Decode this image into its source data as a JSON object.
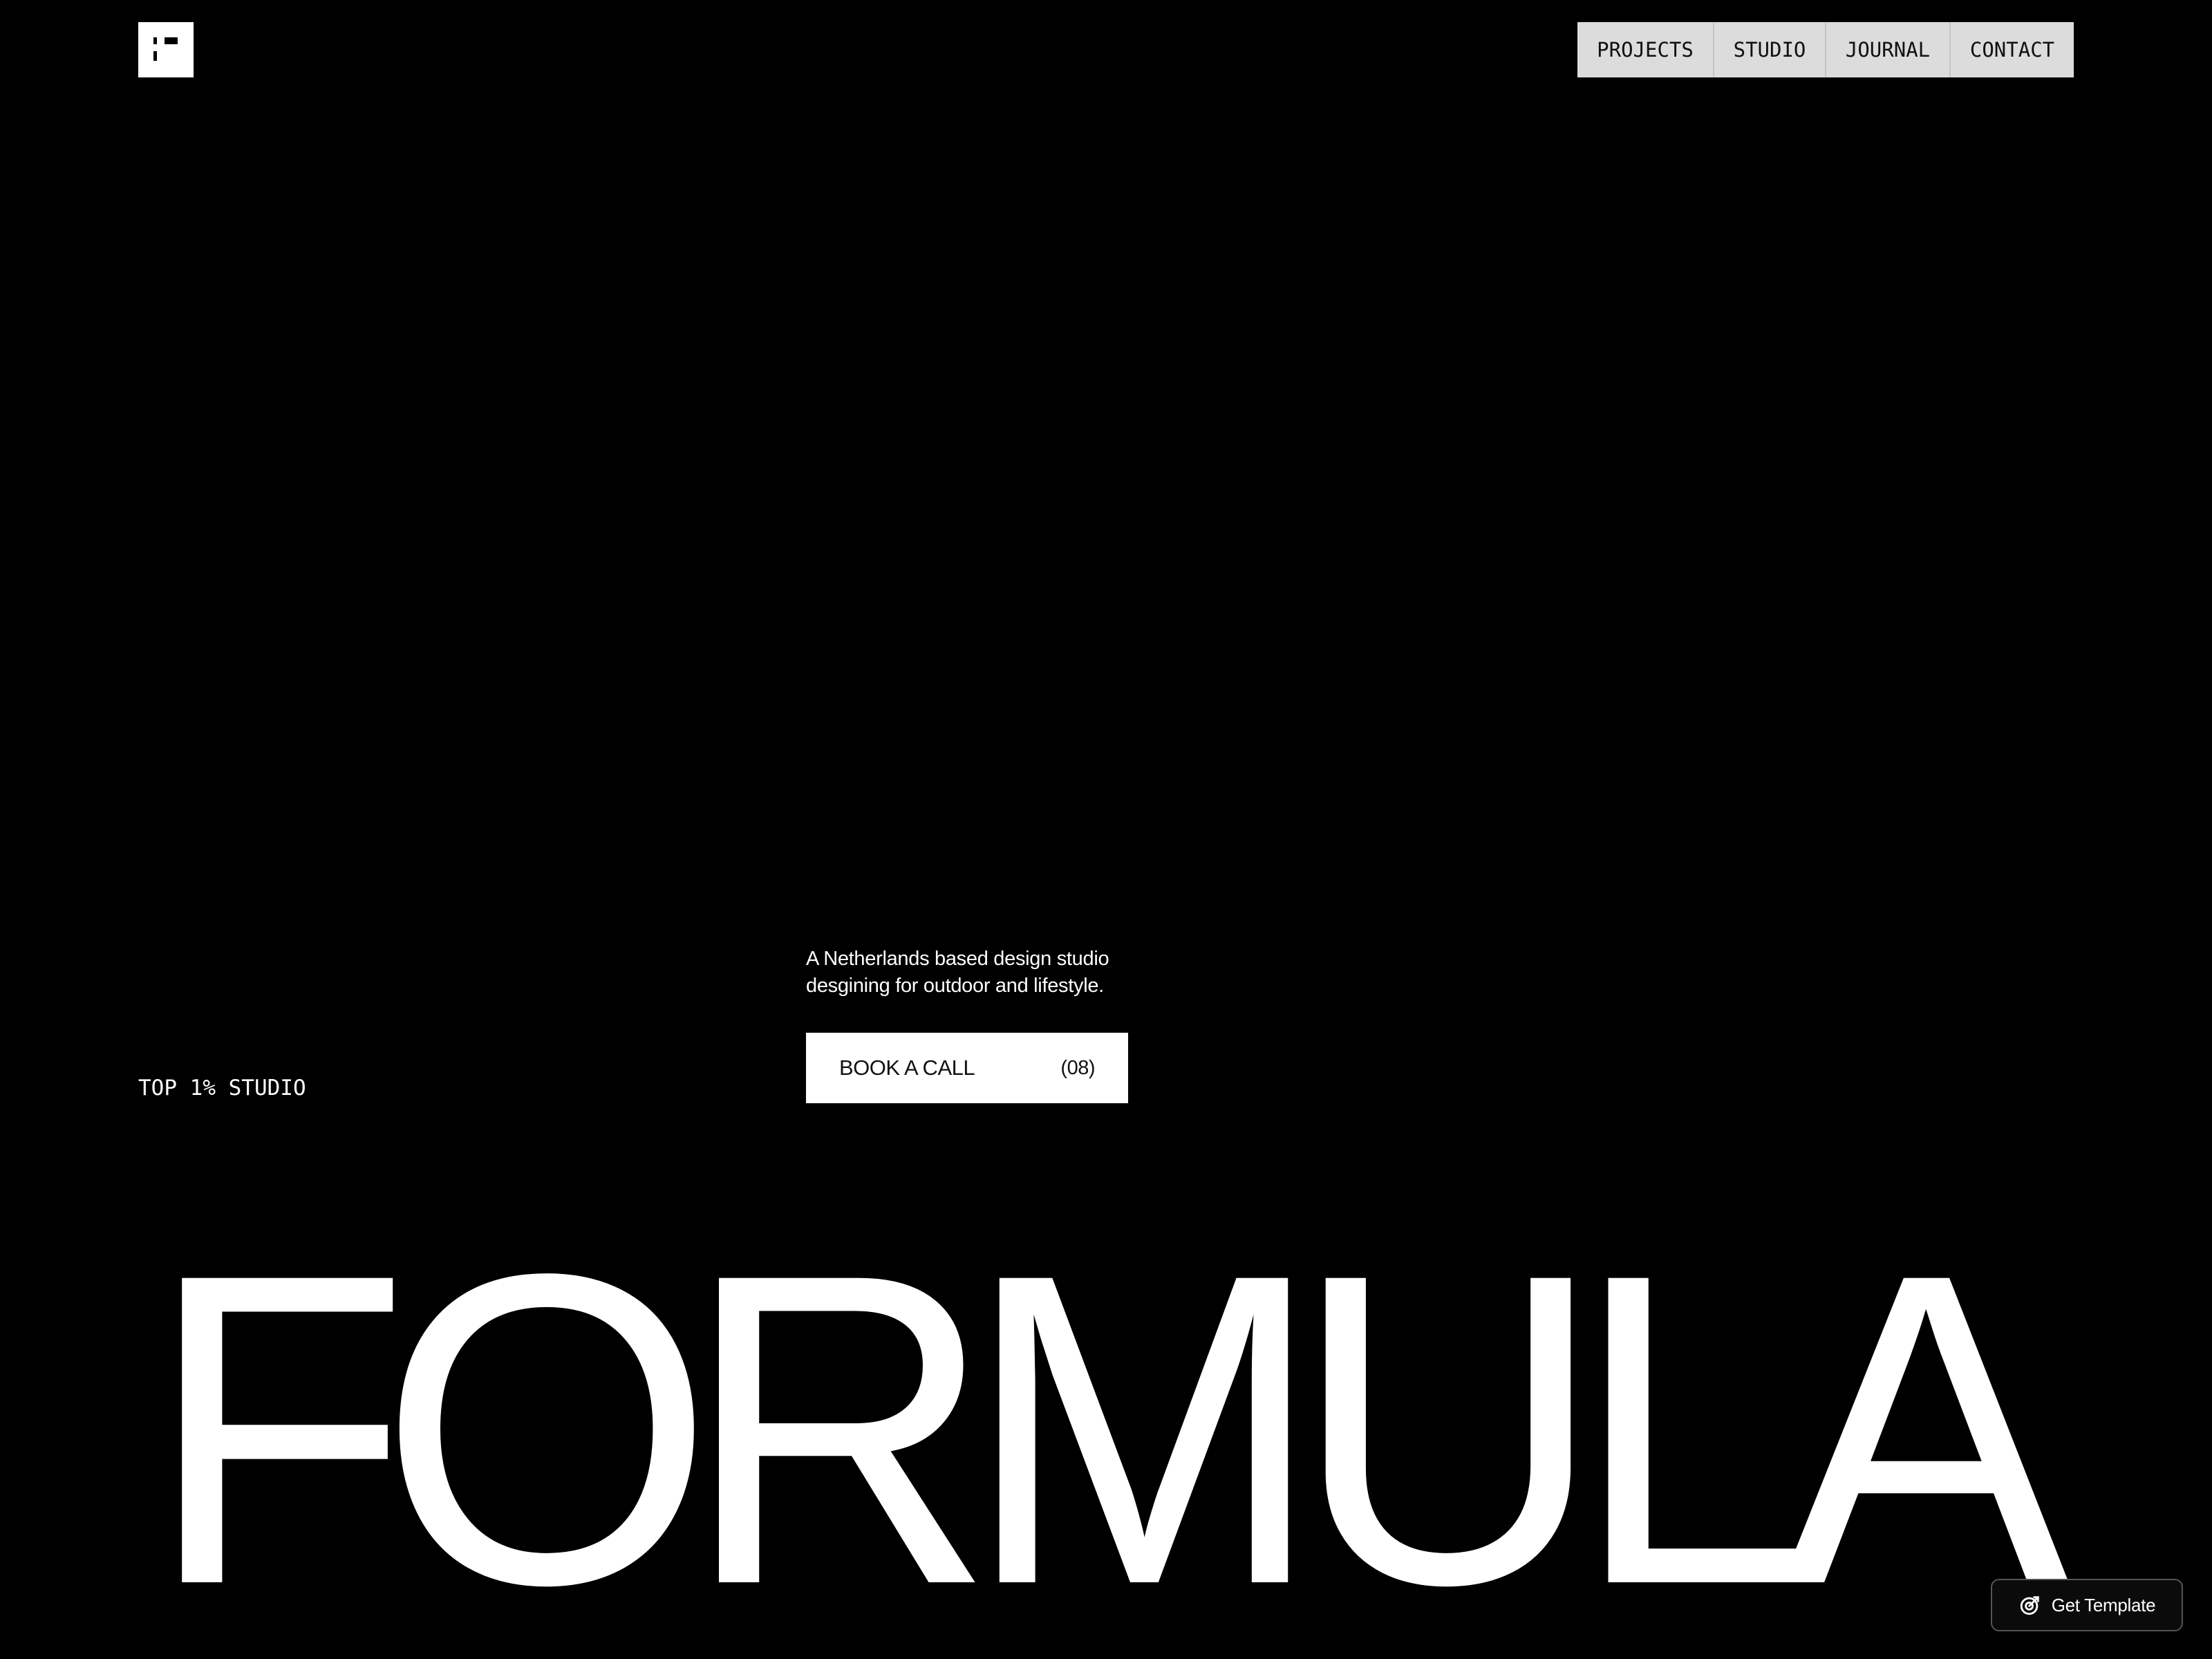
{
  "header": {
    "logo_icon": "formula-logo-icon",
    "nav": [
      {
        "label": "PROJECTS"
      },
      {
        "label": "STUDIO"
      },
      {
        "label": "JOURNAL"
      },
      {
        "label": "CONTACT"
      }
    ]
  },
  "hero": {
    "tagline_line1": "A Netherlands based design studio",
    "tagline_line2": "desgining for outdoor and lifestyle.",
    "cta": {
      "label": "BOOK A CALL",
      "count": "(08)"
    },
    "badge": "TOP 1% STUDIO",
    "headline": "FORMULA"
  },
  "template_button": {
    "label": "Get Template",
    "icon": "framer-target-icon"
  },
  "colors": {
    "background": "#000000",
    "foreground": "#ffffff",
    "nav_background": "#dcdcdc"
  }
}
